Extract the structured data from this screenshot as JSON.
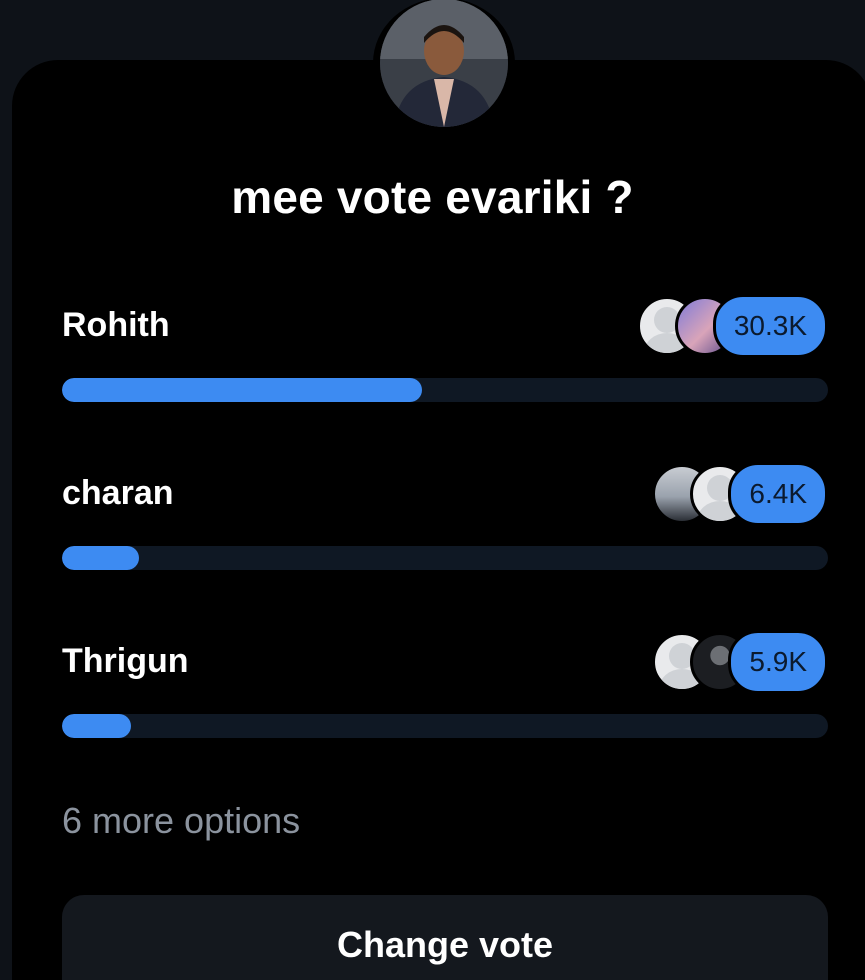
{
  "poll": {
    "title": "mee vote evariki ?",
    "accent_color": "#3d8bf2",
    "options": [
      {
        "label": "Rohith",
        "count": "30.3K",
        "share": 0.47
      },
      {
        "label": "charan",
        "count": "6.4K",
        "share": 0.1
      },
      {
        "label": "Thrigun",
        "count": "5.9K",
        "share": 0.09
      }
    ],
    "more_options": "6 more options",
    "change_vote_label": "Change vote"
  },
  "icons": {
    "host_avatar": "avatar-icon",
    "voter_avatar": "user-avatar-icon"
  }
}
